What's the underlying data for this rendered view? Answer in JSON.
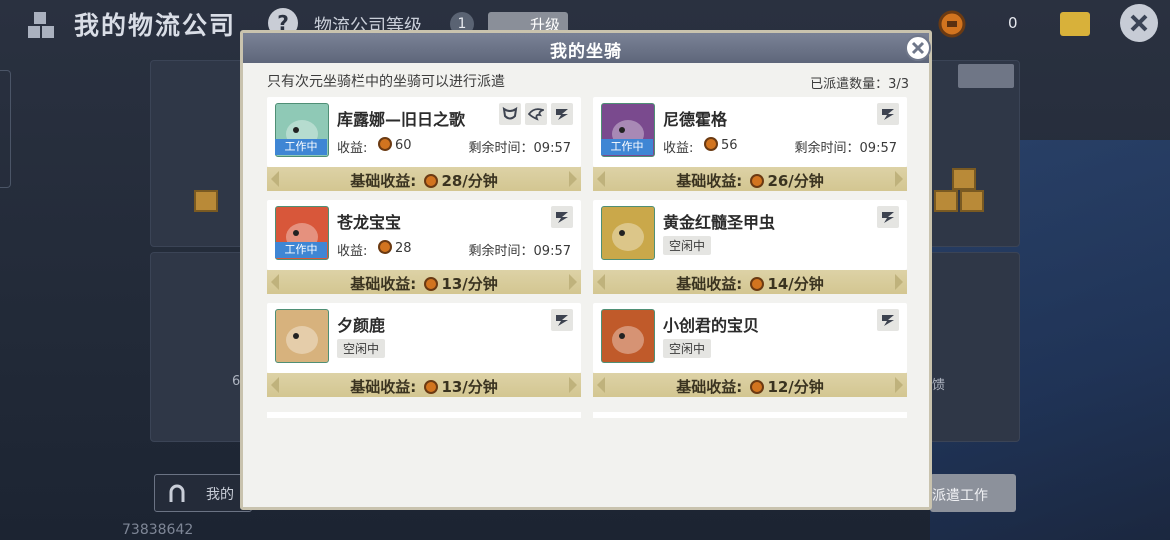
{
  "background": {
    "title": "我的物流公司",
    "level_label": "物流公司等级",
    "level_value": "1",
    "upgrade_label": "升级",
    "coin_value": "0",
    "side_left_char": "6",
    "side_right_char": "馈",
    "bottom_left_label": "我的",
    "dispatch_label": "派遣工作",
    "player_id": "73838642"
  },
  "modal": {
    "title": "我的坐骑",
    "hint": "只有次元坐骑栏中的坐骑可以进行派遣",
    "dispatch_count": "已派遣数量：3/3",
    "mounts": [
      {
        "name": "库露娜—旧日之歌",
        "status": "工作中",
        "earn_label": "收益:",
        "earn_value": "60",
        "remain": "剩余时间：09:57",
        "income": "基础收益: 28/分钟",
        "income_prefix": "基础收益:",
        "income_value": "28/分钟",
        "icons": [
          "mask-icon",
          "wing-icon",
          "speed-icon"
        ],
        "color": "#8fc9b6"
      },
      {
        "name": "尼德霍格",
        "status": "工作中",
        "earn_label": "收益:",
        "earn_value": "56",
        "remain": "剩余时间：09:57",
        "income_prefix": "基础收益:",
        "income_value": "26/分钟",
        "icons": [
          "speed-icon"
        ],
        "color": "#7a4a8e"
      },
      {
        "name": "苍龙宝宝",
        "status": "工作中",
        "earn_label": "收益:",
        "earn_value": "28",
        "remain": "剩余时间：09:57",
        "income_prefix": "基础收益:",
        "income_value": "13/分钟",
        "icons": [
          "speed-icon"
        ],
        "color": "#d8573a"
      },
      {
        "name": "黄金红髓圣甲虫",
        "status": "空闲中",
        "income_prefix": "基础收益:",
        "income_value": "14/分钟",
        "icons": [
          "speed-icon"
        ],
        "color": "#caa84a"
      },
      {
        "name": "夕颜鹿",
        "status": "空闲中",
        "income_prefix": "基础收益:",
        "income_value": "13/分钟",
        "icons": [
          "speed-icon"
        ],
        "color": "#d7b27d"
      },
      {
        "name": "小创君的宝贝",
        "status": "空闲中",
        "income_prefix": "基础收益:",
        "income_value": "12/分钟",
        "icons": [
          "speed-icon"
        ],
        "color": "#c05a2a"
      }
    ]
  }
}
